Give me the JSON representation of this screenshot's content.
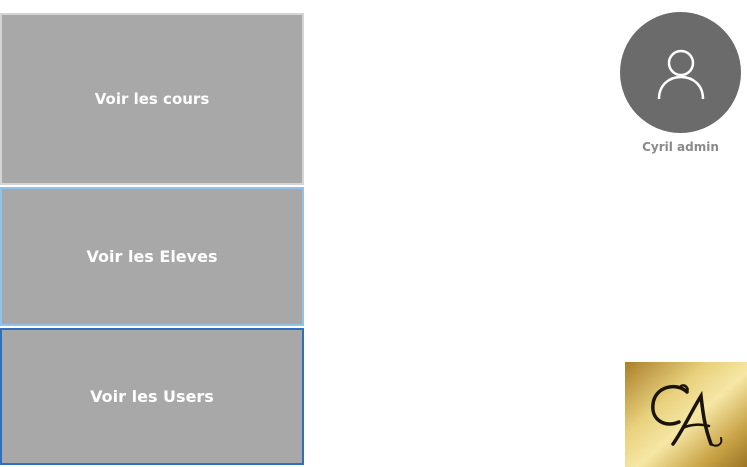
{
  "menu": {
    "cours_label": "Voir les cours",
    "eleves_label": "Voir les Eleves",
    "users_label": "Voir les Users"
  },
  "user": {
    "name": "Cyril admin",
    "avatar_icon": "user-silhouette-icon"
  },
  "logo": {
    "monogram": "CA",
    "icon": "gold-monogram-logo"
  },
  "colors": {
    "button_bg": "#a8a8a8",
    "button_text": "#ffffff",
    "avatar_bg": "#6b6b6b",
    "name_text": "#8a8a8a",
    "focus_border": "#2f6fc0",
    "hover_border": "#8fc3ee"
  }
}
